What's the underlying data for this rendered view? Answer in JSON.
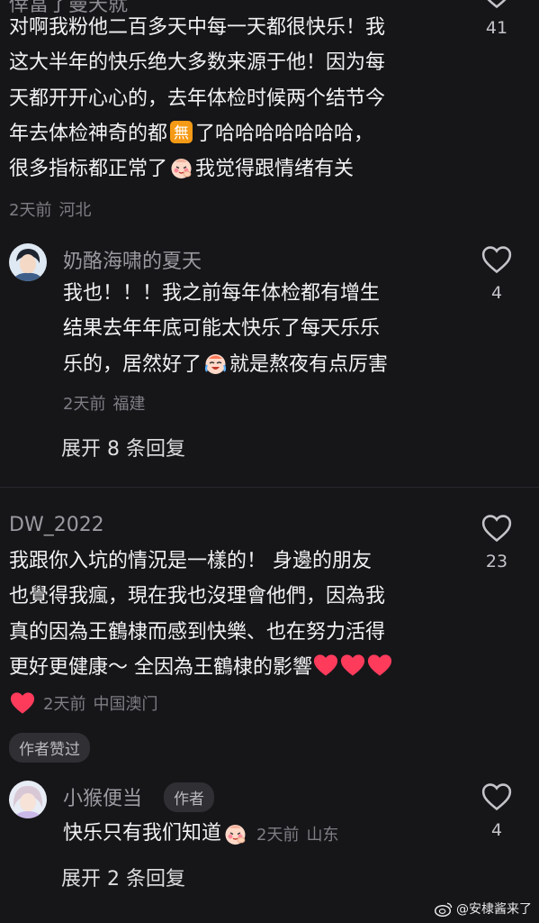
{
  "comment_top": {
    "cut_username": "倖冨了曼天就",
    "lines": [
      "对啊我粉他二百多天中每一天都很快乐！我",
      "这大半年的快乐绝大多数来源于他！因为每",
      "天都开开心心的，去年体检时候两个结节今",
      "年去体检神奇的都",
      "了哈哈哈哈哈哈哈，",
      "很多指标都正常了",
      "我觉得跟情绪有关"
    ],
    "emoji_none": "none-emoji",
    "emoji_blush": "blush-face-emoji",
    "time": "2天前",
    "location": "河北",
    "like_count": "41"
  },
  "reply_1": {
    "username": "奶酪海啸的夏天",
    "lines": [
      "我也！！！我之前每年体检都有增生",
      "结果去年年底可能太快乐了每天乐乐",
      "乐的，居然好了",
      "就是熬夜有点厉害"
    ],
    "emoji": "crying-laugh-emoji",
    "time": "2天前",
    "location": "福建",
    "like_count": "4"
  },
  "expand_1": "展开 8 条回复",
  "comment_2": {
    "username": "DW_2022",
    "lines": [
      "我跟你入坑的情況是一樣的！ 身邊的朋友",
      "也覺得我瘋，現在我也沒理會他們，因為我",
      "真的因為王鶴棣而感到快樂、也在努力活得",
      "更好更健康～ 全因為王鶴棣的影響"
    ],
    "emoji": "red-heart-emoji",
    "time": "2天前",
    "location": "中国澳门",
    "like_count": "23",
    "author_liked": "作者赞过"
  },
  "reply_2": {
    "username": "小猴便当",
    "author_badge": "作者",
    "text": "快乐只有我们知道",
    "emoji": "blush-face-emoji",
    "time": "2天前",
    "location": "山东",
    "like_count": "4"
  },
  "expand_2": "展开 2 条回复",
  "watermark": "@安棣酱来了",
  "colors": {
    "background": "#161619",
    "text": "#f2f2f4",
    "muted": "#7d7d83",
    "heart": "#ff3b5c"
  }
}
